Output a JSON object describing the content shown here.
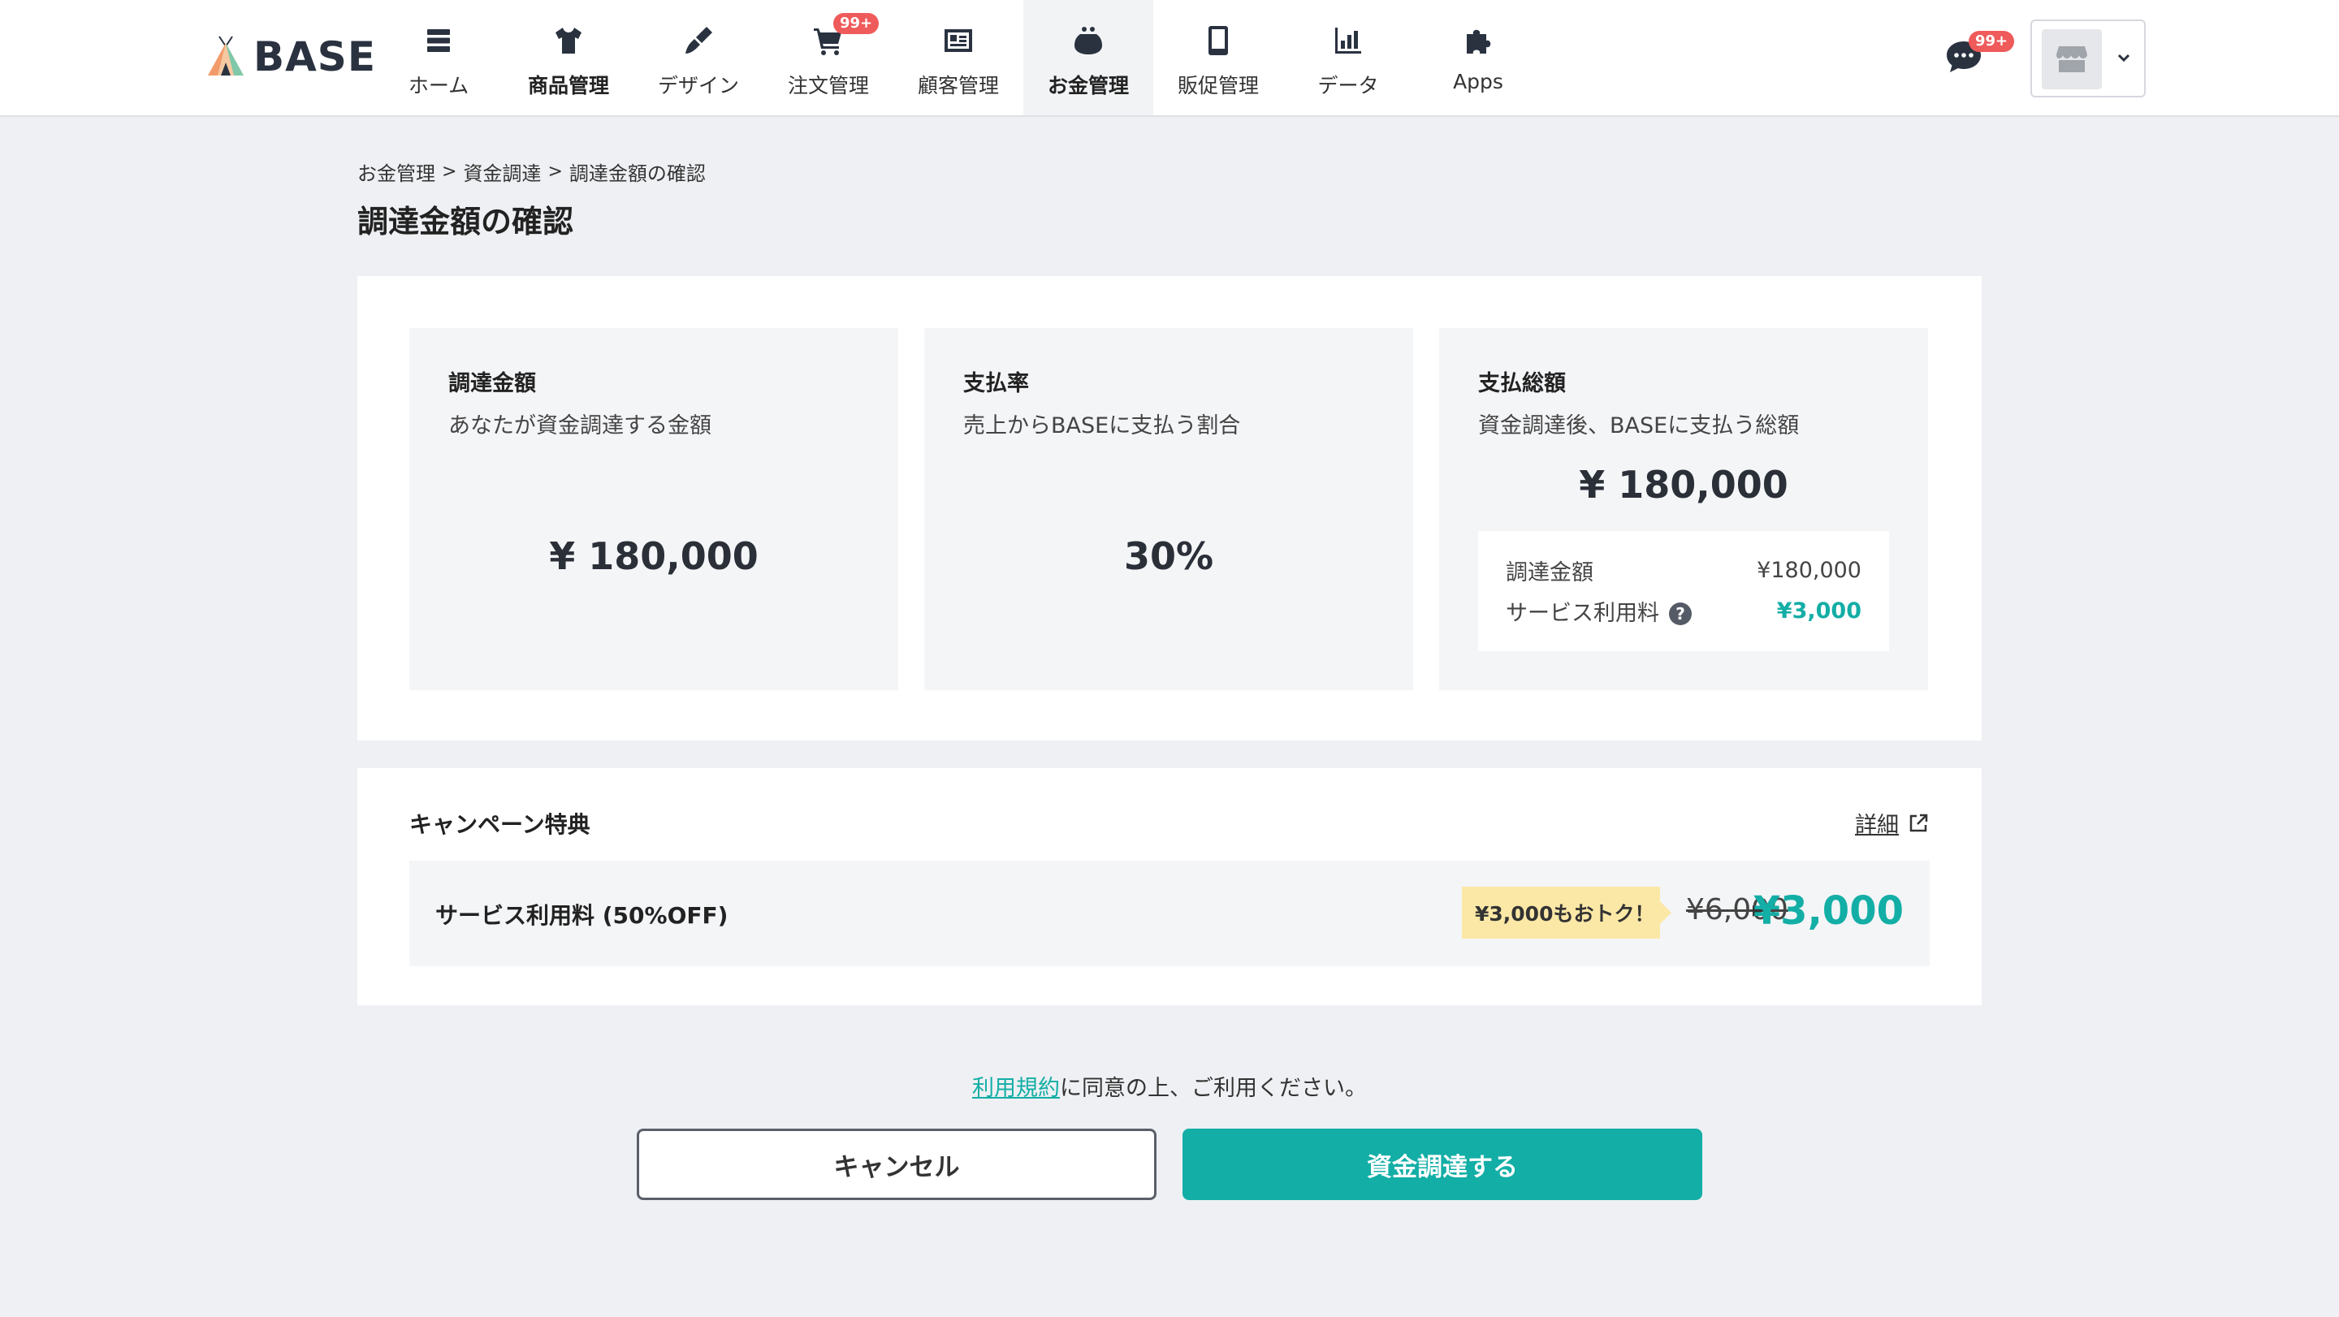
{
  "brand": {
    "name": "BASE"
  },
  "nav": {
    "items": [
      {
        "label": "ホーム",
        "icon": "home-list-icon"
      },
      {
        "label": "商品管理",
        "icon": "tshirt-icon"
      },
      {
        "label": "デザイン",
        "icon": "paintbrush-icon"
      },
      {
        "label": "注文管理",
        "icon": "cart-icon",
        "badge": "99+"
      },
      {
        "label": "顧客管理",
        "icon": "customer-card-icon"
      },
      {
        "label": "お金管理",
        "icon": "purse-icon"
      },
      {
        "label": "販促管理",
        "icon": "smartphone-icon"
      },
      {
        "label": "データ",
        "icon": "bar-chart-icon"
      },
      {
        "label": "Apps",
        "icon": "puzzle-icon"
      }
    ],
    "active": "お金管理"
  },
  "header_right": {
    "chat_badge": "99+"
  },
  "breadcrumb": {
    "items": [
      "お金管理",
      "資金調達",
      "調達金額の確認"
    ],
    "separator": ">"
  },
  "page_title": "調達金額の確認",
  "summary": {
    "funding": {
      "title": "調達金額",
      "desc": "あなたが資金調達する金額",
      "value": "¥ 180,000"
    },
    "rate": {
      "title": "支払率",
      "desc": "売上からBASEに支払う割合",
      "value": "30%"
    },
    "total": {
      "title": "支払総額",
      "desc": "資金調達後、BASEに支払う総額",
      "value": "¥ 180,000",
      "breakdown": {
        "funding_label": "調達金額",
        "funding_value": "¥180,000",
        "fee_label": "サービス利用料",
        "fee_value": "¥3,000",
        "help": "?"
      }
    }
  },
  "campaign": {
    "title": "キャンペーン特典",
    "detail_link": "詳細",
    "row_label": "サービス利用料 (50%OFF)",
    "savings": "¥3,000もおトク！",
    "old_price": "¥6,000",
    "new_price": "¥3,000"
  },
  "agreement": {
    "link": "利用規約",
    "text": "に同意の上、ご利用ください。"
  },
  "buttons": {
    "cancel": "キャンセル",
    "submit": "資金調達する"
  },
  "colors": {
    "accent": "#13aea6",
    "badge": "#ef5a5a",
    "tag": "#fbe8a6"
  }
}
